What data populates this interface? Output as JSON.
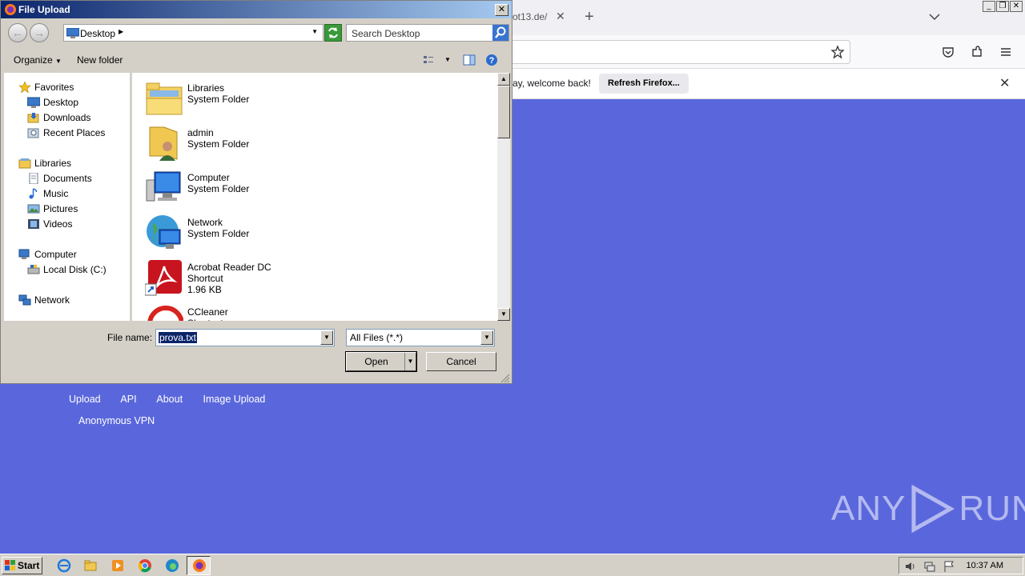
{
  "browser": {
    "tab_title_fragment": "ot13.de/",
    "tab_close": "✕",
    "new_tab": "+",
    "notification": {
      "text_fragment": "ay, welcome back!",
      "refresh_label": "Refresh Firefox...",
      "close": "✕"
    },
    "window_controls": [
      "_",
      "❐",
      "✕"
    ]
  },
  "site": {
    "nav": [
      "Upload",
      "API",
      "About",
      "Image Upload"
    ],
    "nav2": "Anonymous VPN",
    "watermark_left": "ANY",
    "watermark_right": "RUN"
  },
  "dialog": {
    "title": "File Upload",
    "close": "✕",
    "back": "←",
    "forward": "→",
    "address": "Desktop",
    "search_placeholder": "Search Desktop",
    "organize": "Organize",
    "new_folder": "New folder",
    "tree": [
      {
        "label": "Favorites",
        "icon": "star-icon",
        "level": 0
      },
      {
        "label": "Desktop",
        "icon": "desktop-icon",
        "level": 1
      },
      {
        "label": "Downloads",
        "icon": "downloads-icon",
        "level": 1
      },
      {
        "label": "Recent Places",
        "icon": "recent-places-icon",
        "level": 1
      },
      {
        "label": "Libraries",
        "icon": "libraries-icon",
        "level": 0
      },
      {
        "label": "Documents",
        "icon": "documents-icon",
        "level": 1
      },
      {
        "label": "Music",
        "icon": "music-icon",
        "level": 1
      },
      {
        "label": "Pictures",
        "icon": "pictures-icon",
        "level": 1
      },
      {
        "label": "Videos",
        "icon": "videos-icon",
        "level": 1
      },
      {
        "label": "Computer",
        "icon": "computer-icon",
        "level": 0
      },
      {
        "label": "Local Disk (C:)",
        "icon": "disk-icon",
        "level": 1
      },
      {
        "label": "Network",
        "icon": "network-icon",
        "level": 0
      }
    ],
    "files": [
      {
        "name": "Libraries",
        "type": "System Folder",
        "size": "",
        "icon": "libraries-folder-icon"
      },
      {
        "name": "admin",
        "type": "System Folder",
        "size": "",
        "icon": "user-folder-icon"
      },
      {
        "name": "Computer",
        "type": "System Folder",
        "size": "",
        "icon": "computer-icon"
      },
      {
        "name": "Network",
        "type": "System Folder",
        "size": "",
        "icon": "network-globe-icon"
      },
      {
        "name": "Acrobat Reader DC",
        "type": "Shortcut",
        "size": "1.96 KB",
        "icon": "acrobat-icon"
      },
      {
        "name": "CCleaner",
        "type": "Shortcut",
        "size": "",
        "icon": "ccleaner-icon"
      }
    ],
    "file_name_label": "File name:",
    "file_name_value": "prova.txt",
    "file_type_value": "All Files (*.*)",
    "open_label": "Open",
    "cancel_label": "Cancel"
  },
  "taskbar": {
    "start_label": "Start",
    "time": "10:37 AM"
  }
}
